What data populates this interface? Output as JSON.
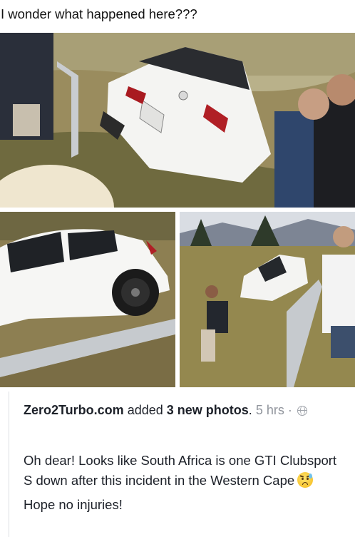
{
  "top_caption": "I wonder what happened here???",
  "photos": [
    {
      "alt": "White hatchback nose-down in a grassy ditch behind guardrail with onlookers"
    },
    {
      "alt": "White hatchback side view tilted beside guardrail"
    },
    {
      "alt": "Man crouching near car in ditch beside guardrail"
    }
  ],
  "post": {
    "page_name": "Zero2Turbo.com",
    "action_text": "added",
    "photos_count_text": "3 new photos",
    "period": ".",
    "time": "5 hrs",
    "separator": "·",
    "privacy_icon": "globe-icon",
    "body_line_1": "Oh dear! Looks like South Africa is one GTI Clubsport S down after this incident in the Western Cape",
    "emoji": "sad-relieved-face-emoji",
    "body_line_2": "Hope no injuries!"
  },
  "colors": {
    "text": "#1d2129",
    "meta": "#90949c",
    "divider": "#dddfe2"
  }
}
